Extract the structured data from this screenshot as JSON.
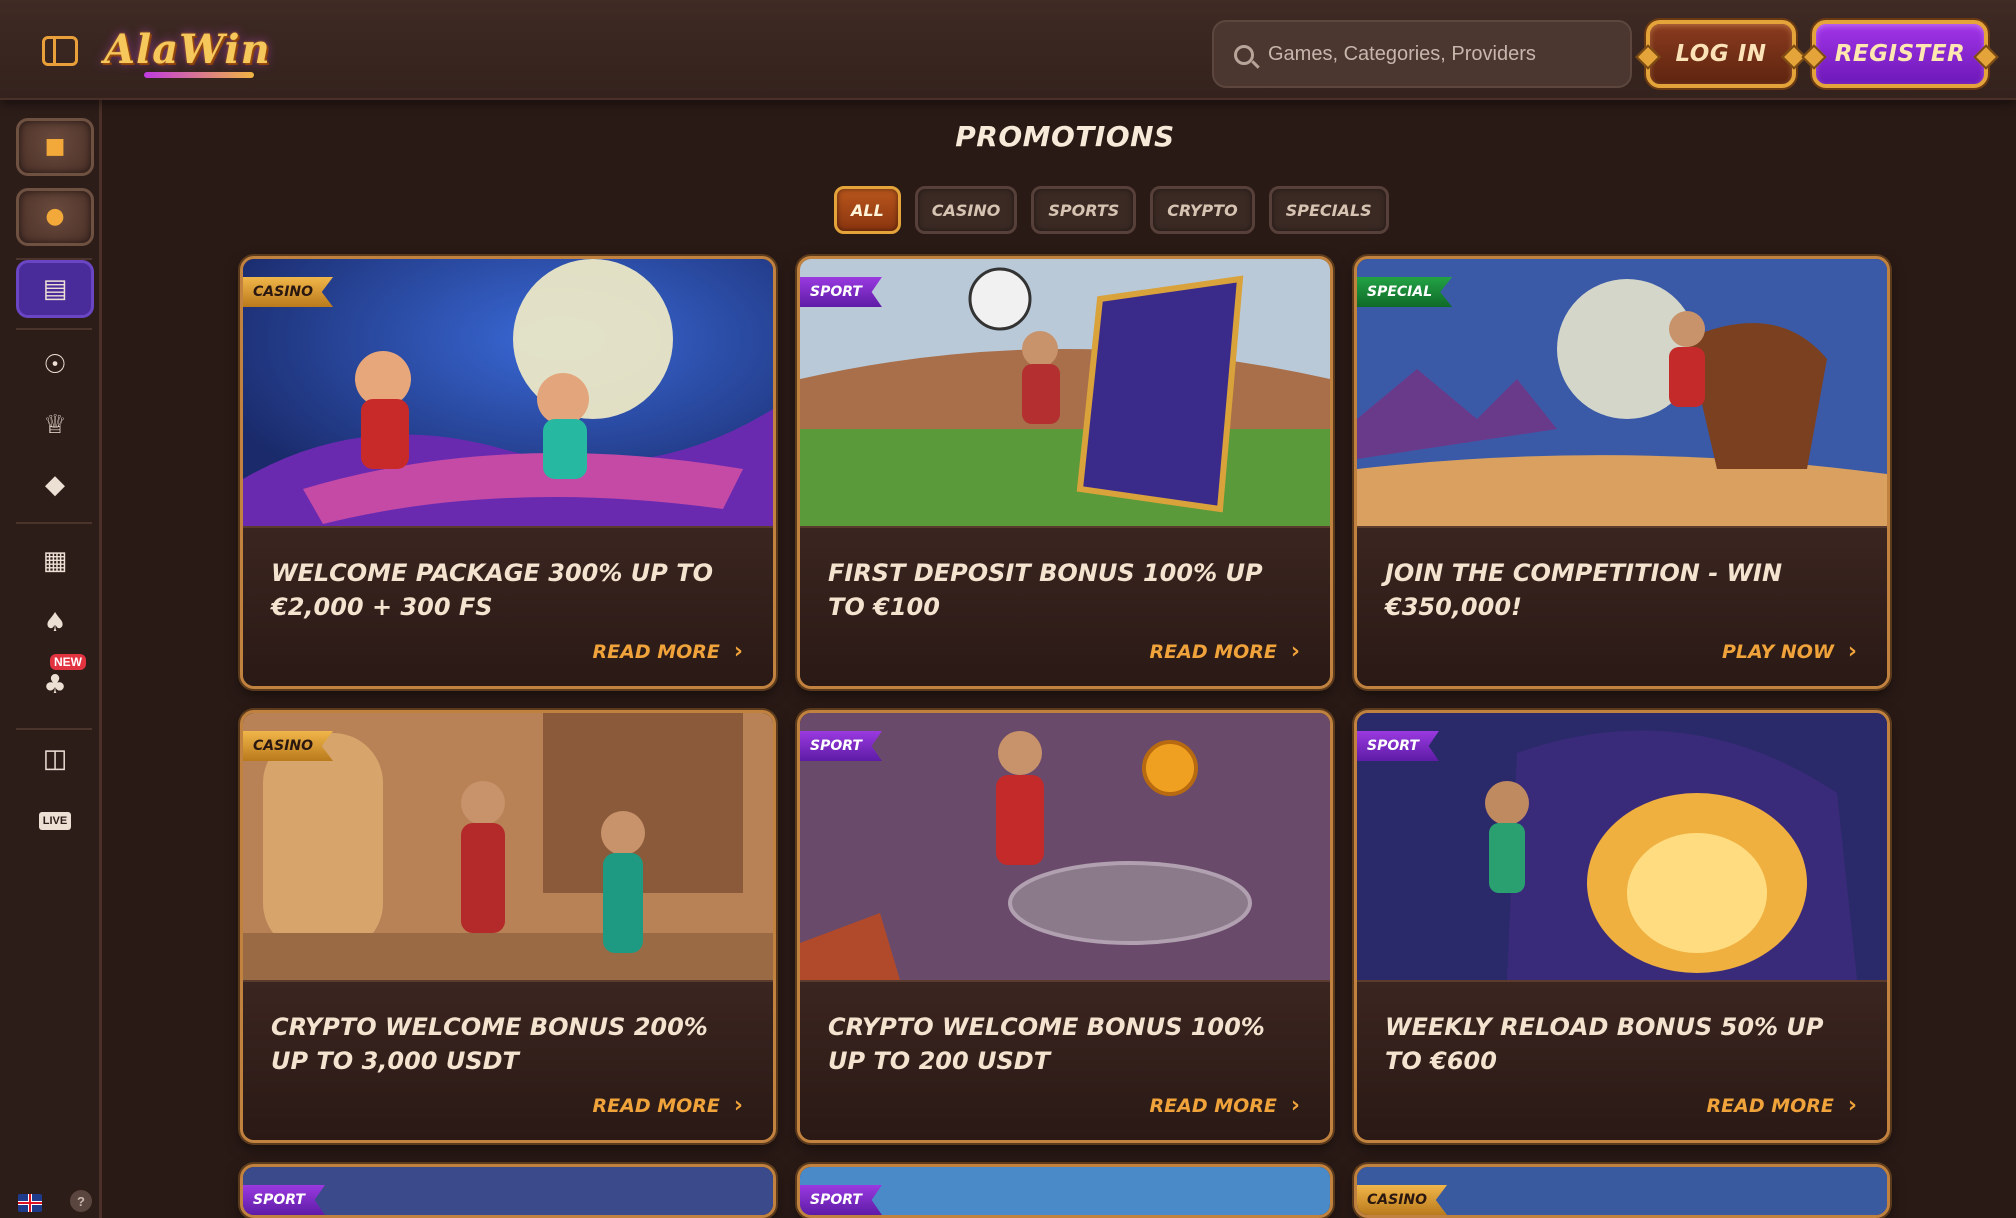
{
  "header": {
    "brand": "AlaWin",
    "search_placeholder": "Games, Categories, Providers",
    "login_label": "LOG IN",
    "register_label": "REGISTER"
  },
  "sidebar": {
    "items": [
      {
        "icon": "gold-cube-icon"
      },
      {
        "icon": "gold-ball-icon"
      },
      {
        "icon": "promotions-icon"
      },
      {
        "icon": "medal-icon"
      },
      {
        "icon": "trophy-icon"
      },
      {
        "icon": "diamond-icon"
      },
      {
        "icon": "slot-machine-icon"
      },
      {
        "icon": "cards-icon"
      },
      {
        "icon": "clover-icon",
        "badge": "NEW"
      },
      {
        "icon": "ticket-icon"
      },
      {
        "icon": "live-icon",
        "label": "LIVE"
      }
    ],
    "help_label": "?"
  },
  "main": {
    "title": "PROMOTIONS",
    "filters": [
      "ALL",
      "CASINO",
      "SPORTS",
      "CRYPTO",
      "SPECIALS"
    ],
    "active_filter": "ALL",
    "cards": [
      {
        "tag": "CASINO",
        "title": "WELCOME PACKAGE 300% UP TO €2,000 + 300 FS",
        "cta": "READ MORE"
      },
      {
        "tag": "SPORT",
        "title": "FIRST DEPOSIT BONUS 100% UP TO €100",
        "cta": "READ MORE"
      },
      {
        "tag": "SPECIAL",
        "title": "JOIN THE COMPETITION - WIN €350,000!",
        "cta": "PLAY NOW"
      },
      {
        "tag": "CASINO",
        "title": "CRYPTO WELCOME BONUS 200% UP TO 3,000 USDT",
        "cta": "READ MORE"
      },
      {
        "tag": "SPORT",
        "title": "CRYPTO WELCOME BONUS 100% UP TO 200 USDT",
        "cta": "READ MORE"
      },
      {
        "tag": "SPORT",
        "title": "WEEKLY RELOAD BONUS 50% UP TO €600",
        "cta": "READ MORE"
      },
      {
        "tag": "SPORT"
      },
      {
        "tag": "SPORT"
      },
      {
        "tag": "CASINO"
      }
    ]
  },
  "colors": {
    "background": "#2a1a16",
    "accent_gold": "#f0a33a",
    "register_purple": "#8a2ad6",
    "sport_tag": "#7a2ad0",
    "casino_tag": "#e5a43a",
    "special_tag": "#23a245"
  }
}
